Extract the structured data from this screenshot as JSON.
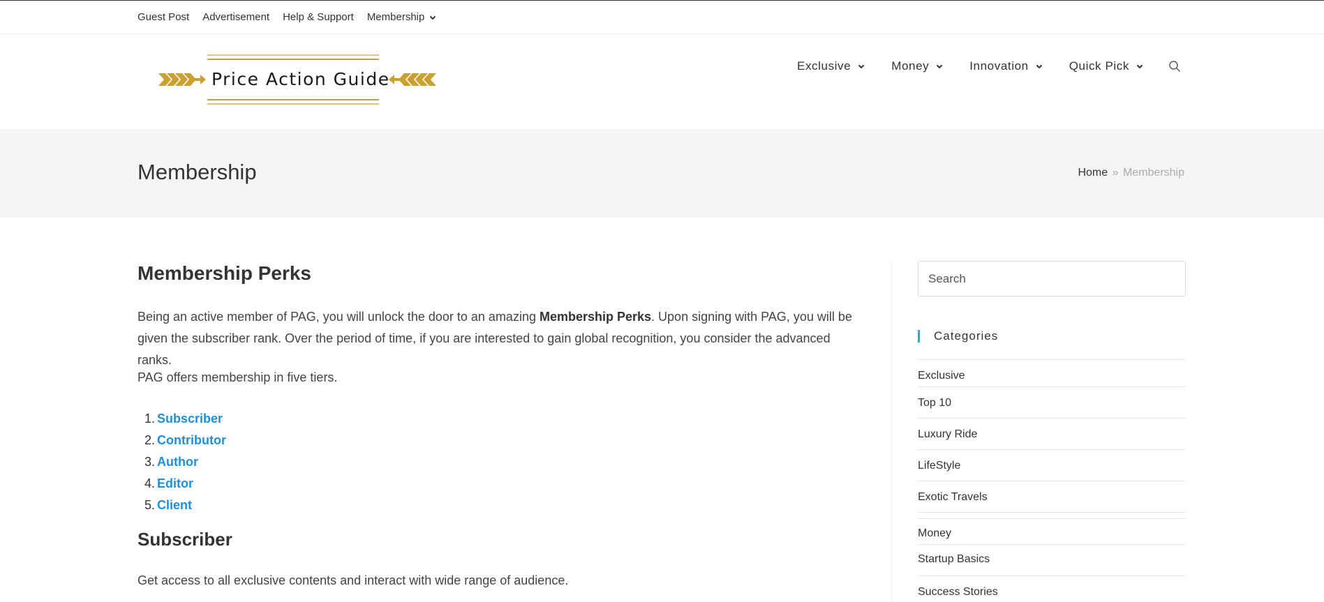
{
  "topbar": {
    "items": [
      {
        "label": "Guest Post"
      },
      {
        "label": "Advertisement"
      },
      {
        "label": "Help & Support"
      },
      {
        "label": "Membership",
        "has_dropdown": true
      }
    ]
  },
  "header": {
    "logo_text": "Price Action Guide",
    "logo_color": "#c9a133",
    "nav": [
      {
        "label": "Exclusive"
      },
      {
        "label": "Money"
      },
      {
        "label": "Innovation"
      },
      {
        "label": "Quick Pick"
      }
    ]
  },
  "page_header": {
    "title": "Membership",
    "breadcrumb": {
      "home": "Home",
      "separator": "»",
      "current": "Membership"
    }
  },
  "content": {
    "heading": "Membership Perks",
    "intro_part1": "Being an active member of PAG, you will unlock the door to an amazing ",
    "intro_bold": "Membership Perks",
    "intro_part2": ". Upon signing with PAG, you will be given the subscriber rank. Over the period of time, if you are interested to gain global recognition, you consider the advanced ranks.",
    "tiers_intro": "PAG offers membership in five tiers.",
    "tiers": [
      {
        "num": "1.",
        "label": "Subscriber"
      },
      {
        "num": "2.",
        "label": "Contributor"
      },
      {
        "num": "3.",
        "label": "Author"
      },
      {
        "num": "4.",
        "label": "Editor"
      },
      {
        "num": "5.",
        "label": "Client"
      }
    ],
    "subheading": "Subscriber",
    "subscriber_text": "Get access to all exclusive contents and interact with wide range of audience."
  },
  "sidebar": {
    "search_placeholder": "Search",
    "categories_title": "Categories",
    "categories": [
      {
        "label": "Exclusive"
      },
      {
        "label": "Top 10"
      },
      {
        "label": "Luxury Ride"
      },
      {
        "label": "LifeStyle"
      },
      {
        "label": "Exotic Travels"
      },
      {
        "label": "Money"
      },
      {
        "label": "Startup Basics"
      },
      {
        "label": "Success Stories"
      }
    ]
  },
  "colors": {
    "accent": "#13aff0",
    "link": "#1e8fd8",
    "page_band": "#f5f5f5"
  }
}
